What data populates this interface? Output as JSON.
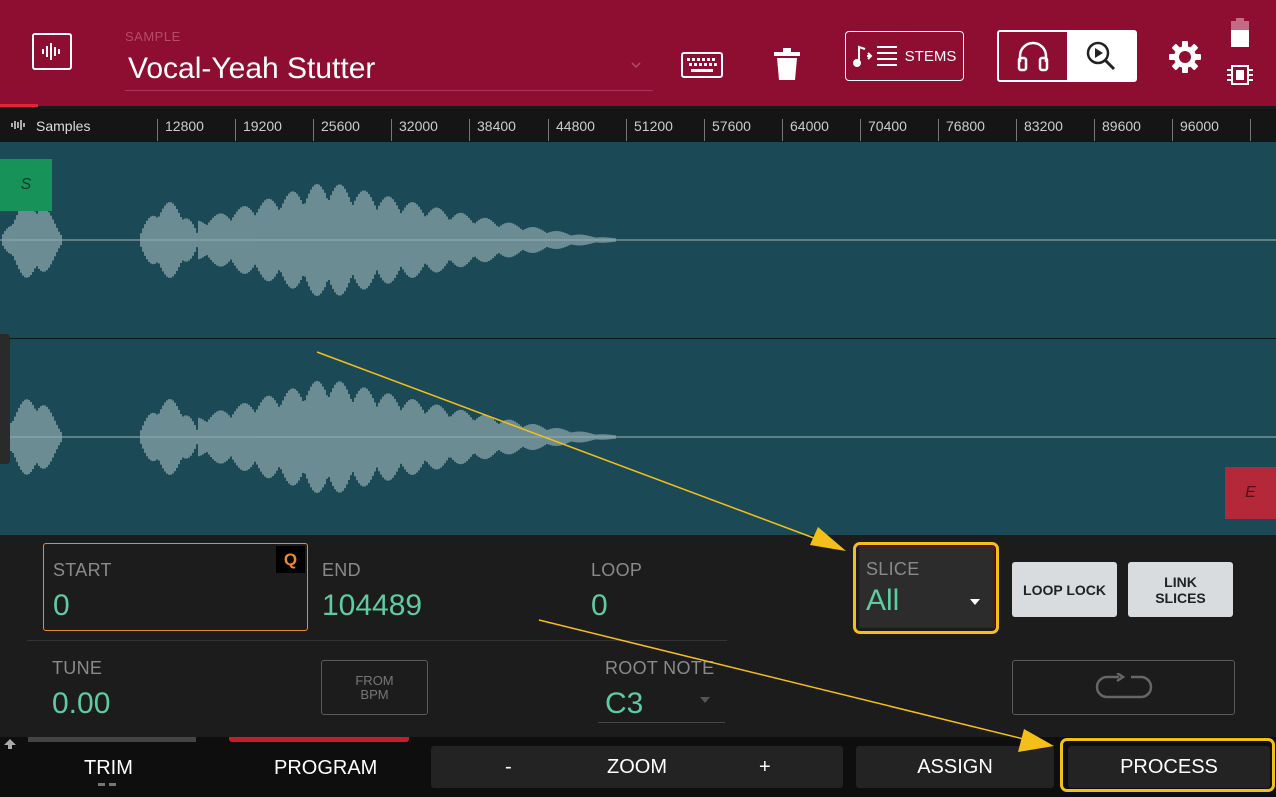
{
  "header": {
    "small_label": "SAMPLE",
    "sample_name": "Vocal-Yeah Stutter",
    "stems_label": "STEMS",
    "icons": {
      "logo": "waveform-icon",
      "keyboard": "keyboard-icon",
      "delete": "trash-icon",
      "stems": "stems-icon",
      "listen": "headphones-icon",
      "zoom": "zoom-play-icon",
      "settings": "gear-icon",
      "battery": "battery-icon",
      "memory": "chip-icon"
    }
  },
  "ruler": {
    "title": "Samples",
    "ticks": [
      "12800",
      "19200",
      "25600",
      "32000",
      "38400",
      "44800",
      "51200",
      "57600",
      "64000",
      "70400",
      "76800",
      "83200",
      "89600",
      "96000"
    ]
  },
  "waveform": {
    "start_marker": "S",
    "end_marker": "E"
  },
  "params": {
    "start": {
      "label": "START",
      "value": "0",
      "badge": "Q"
    },
    "end": {
      "label": "END",
      "value": "104489"
    },
    "loop": {
      "label": "LOOP",
      "value": "0"
    },
    "slice": {
      "label": "SLICE",
      "value": "All"
    },
    "loop_lock": "LOOP LOCK",
    "link_slices": "LINK\nSLICES",
    "tune": {
      "label": "TUNE",
      "value": "0.00"
    },
    "from_bpm": "FROM\nBPM",
    "root_note": {
      "label": "ROOT NOTE",
      "value": "C3"
    }
  },
  "footer": {
    "trim": "TRIM",
    "program": "PROGRAM",
    "zoom_minus": "-",
    "zoom": "ZOOM",
    "zoom_plus": "+",
    "assign": "ASSIGN",
    "process": "PROCESS"
  },
  "colors": {
    "header_bg": "#8e0e32",
    "wave_bg": "#1b4a56",
    "value_green": "#5ecba1",
    "start_orange": "#f08a24",
    "highlight": "#f5bf1a"
  }
}
